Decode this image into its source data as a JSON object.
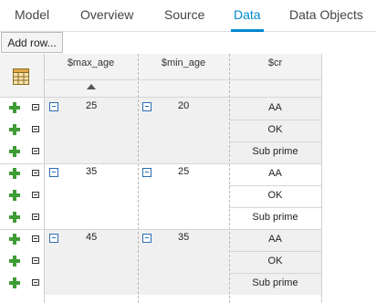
{
  "tabs": [
    {
      "label": "Model",
      "active": false
    },
    {
      "label": "Overview",
      "active": false
    },
    {
      "label": "Source",
      "active": false
    },
    {
      "label": "Data",
      "active": true
    },
    {
      "label": "Data Objects",
      "active": false
    }
  ],
  "toolbar": {
    "add_row_label": "Add row..."
  },
  "table": {
    "columns": [
      "$max_age",
      "$min_age",
      "$cr"
    ],
    "sort": {
      "column": "$max_age",
      "direction": "ascending"
    },
    "groups": [
      {
        "max_age": "25",
        "min_age": "20",
        "cr_values": [
          "AA",
          "OK",
          "Sub prime"
        ]
      },
      {
        "max_age": "35",
        "min_age": "25",
        "cr_values": [
          "AA",
          "OK",
          "Sub prime"
        ]
      },
      {
        "max_age": "45",
        "min_age": "35",
        "cr_values": [
          "AA",
          "OK",
          "Sub prime"
        ]
      }
    ]
  },
  "icons": {
    "corner": "grid-table-icon",
    "add": "plus-icon",
    "delete": "minus-box-icon",
    "merge": "collapse-icon",
    "sort": "sort-up-icon"
  },
  "colors": {
    "accent": "#0088ce",
    "plus": "#3f9c35",
    "band": "#f0f0f0"
  }
}
